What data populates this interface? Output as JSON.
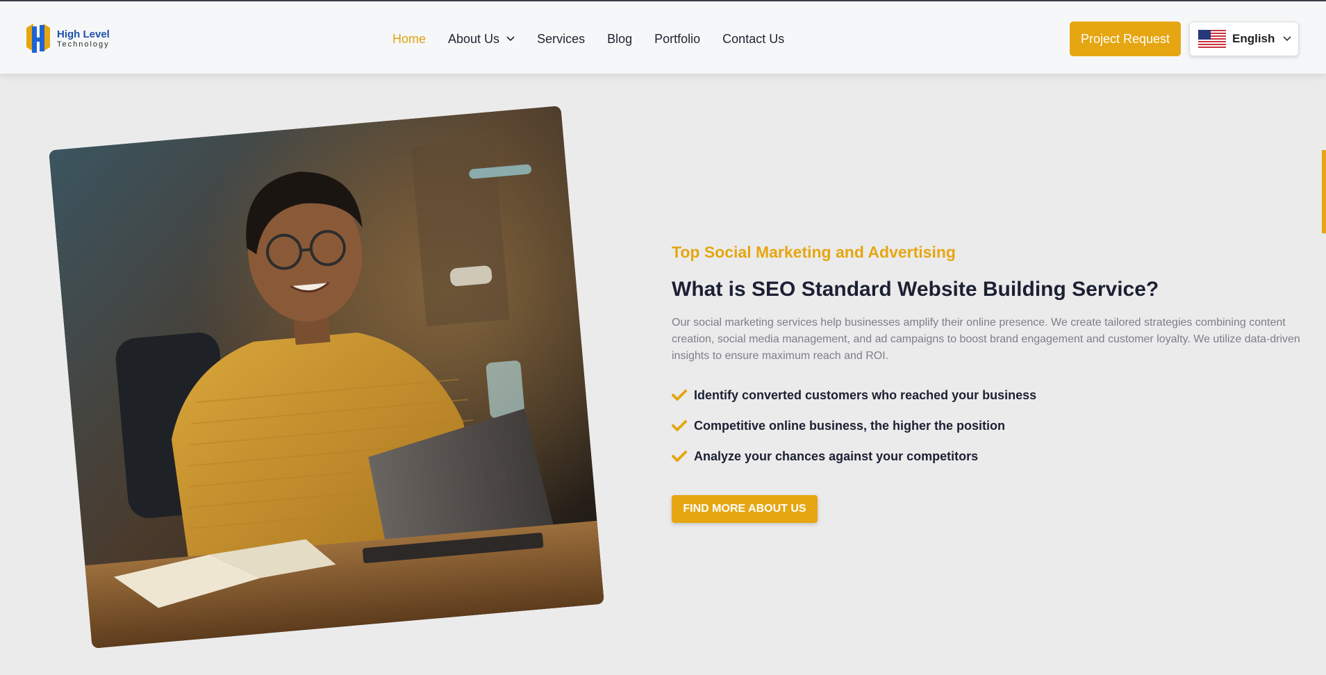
{
  "brand": {
    "title": "High Level",
    "subtitle": "Technology"
  },
  "nav": {
    "items": [
      {
        "label": "Home",
        "active": true
      },
      {
        "label": "About Us",
        "dropdown": true
      },
      {
        "label": "Services"
      },
      {
        "label": "Blog"
      },
      {
        "label": "Portfolio"
      },
      {
        "label": "Contact Us"
      }
    ]
  },
  "header_actions": {
    "project_request_label": "Project Request",
    "language": {
      "selected": "English",
      "flag_icon": "us-flag-icon"
    }
  },
  "hero": {
    "eyebrow": "Top Social Marketing and Advertising",
    "heading": "What is SEO Standard Website Building Service?",
    "paragraph": "Our social marketing services help businesses amplify their online presence. We create tailored strategies combining content creation, social media management, and ad campaigns to boost brand engagement and customer loyalty. We utilize data-driven insights to ensure maximum reach and ROI.",
    "checklist": [
      "Identify converted customers who reached your business",
      "Competitive online business, the higher the position",
      "Analyze your chances against your competitors"
    ],
    "cta_label": "FIND MORE ABOUT US",
    "image_icon": "woman-working-laptop-photo"
  },
  "colors": {
    "accent": "#e5a611",
    "heading": "#1b2033",
    "muted": "#7b7f87",
    "background": "#ecebeb"
  }
}
